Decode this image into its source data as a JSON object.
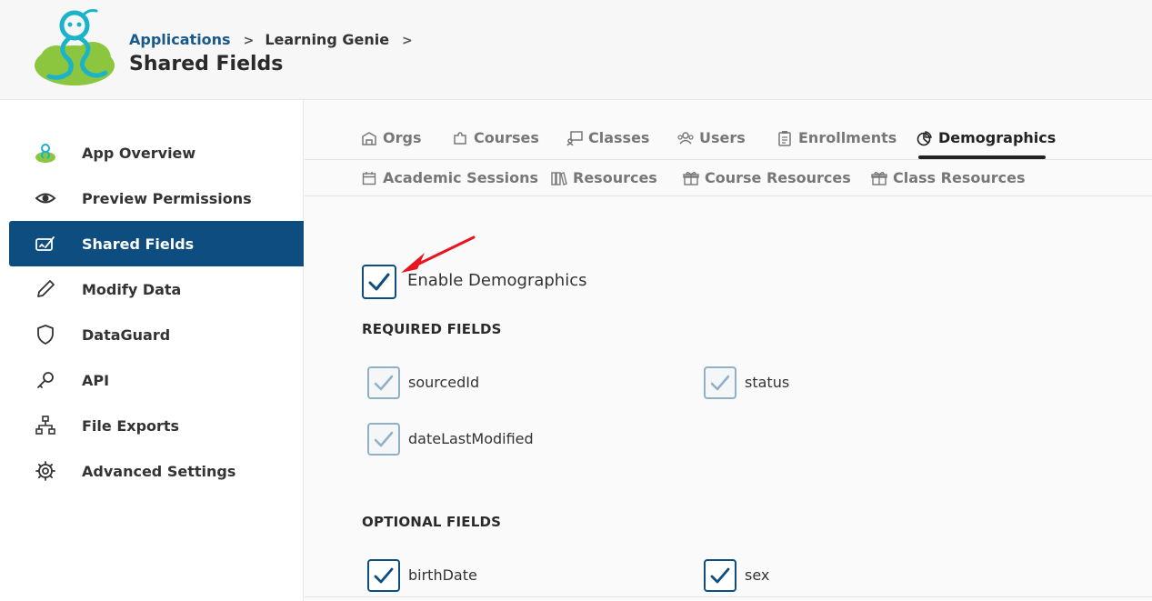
{
  "header": {
    "breadcrumb": [
      "Applications",
      "Learning Genie"
    ],
    "separator": ">",
    "page_title": "Shared Fields"
  },
  "sidebar": {
    "items": [
      {
        "label": "App Overview",
        "icon": "genie-icon"
      },
      {
        "label": "Preview Permissions",
        "icon": "eye-icon"
      },
      {
        "label": "Shared Fields",
        "icon": "shared-fields-icon",
        "active": true
      },
      {
        "label": "Modify Data",
        "icon": "pencil-icon"
      },
      {
        "label": "DataGuard",
        "icon": "shield-icon"
      },
      {
        "label": "API",
        "icon": "key-icon"
      },
      {
        "label": "File Exports",
        "icon": "sitemap-icon"
      },
      {
        "label": "Advanced Settings",
        "icon": "gear-icon"
      }
    ]
  },
  "tabs": {
    "row1": [
      {
        "label": "Orgs",
        "icon": "building-icon"
      },
      {
        "label": "Courses",
        "icon": "puzzle-icon"
      },
      {
        "label": "Classes",
        "icon": "chalkboard-icon"
      },
      {
        "label": "Users",
        "icon": "users-icon"
      },
      {
        "label": "Enrollments",
        "icon": "clipboard-icon"
      },
      {
        "label": "Demographics",
        "icon": "pie-chart-icon",
        "active": true
      }
    ],
    "row2": [
      {
        "label": "Academic Sessions",
        "icon": "calendar-icon"
      },
      {
        "label": "Resources",
        "icon": "books-icon"
      },
      {
        "label": "Course Resources",
        "icon": "gift-box-icon"
      },
      {
        "label": "Class Resources",
        "icon": "gift-box-icon"
      }
    ]
  },
  "main": {
    "enable_label": "Enable Demographics",
    "enable_checked": true,
    "required_title": "REQUIRED FIELDS",
    "required_fields": [
      "sourcedId",
      "status",
      "dateLastModified"
    ],
    "optional_title": "OPTIONAL FIELDS",
    "optional_fields": [
      "birthDate",
      "sex"
    ]
  },
  "colors": {
    "accent": "#0e4d7f",
    "annotation_arrow": "#e8141e"
  }
}
